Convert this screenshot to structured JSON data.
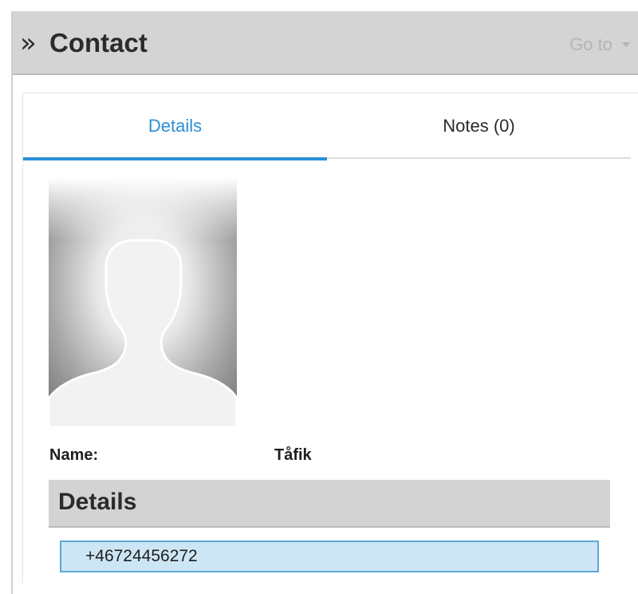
{
  "header": {
    "title": "Contact",
    "collapse_glyph": "»",
    "goto_label": "Go to"
  },
  "tabs": [
    {
      "label": "Details",
      "active": true
    },
    {
      "label": "Notes (0)",
      "active": false
    }
  ],
  "contact": {
    "name_label": "Name:",
    "name_value": "Tåfik",
    "photo_icon": "avatar-placeholder-silhouette"
  },
  "details_section": {
    "title": "Details",
    "items": [
      {
        "value": "+46724456272",
        "selected": true
      }
    ]
  },
  "colors": {
    "header_bg": "#d4d4d4",
    "accent_blue": "#2b8fd6",
    "selected_bg": "#cde6f5",
    "selected_border": "#5ea8d6"
  }
}
